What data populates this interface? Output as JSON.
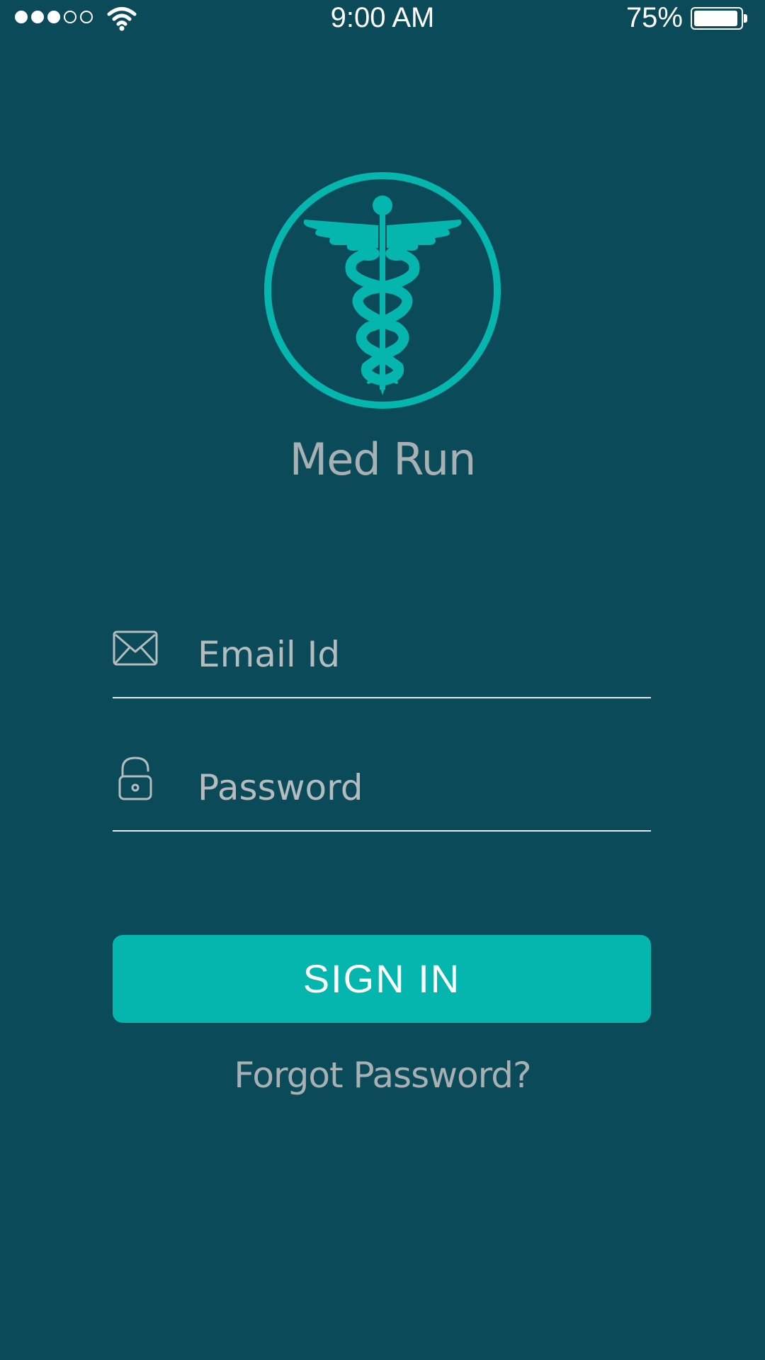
{
  "status_bar": {
    "signal_total": 5,
    "signal_filled": 3,
    "time": "9:00 AM",
    "battery_percent": "75%",
    "battery_level": 0.95,
    "wifi_icon": "wifi-icon"
  },
  "logo": {
    "icon": "caduceus-icon",
    "color": "#04b6ad"
  },
  "app_name": "Med Run",
  "form": {
    "email": {
      "icon": "mail-icon",
      "placeholder": "Email Id",
      "value": ""
    },
    "password": {
      "icon": "lock-icon",
      "placeholder": "Password",
      "value": ""
    }
  },
  "sign_in_label": "SIGN IN",
  "forgot_password_label": "Forgot Password?",
  "colors": {
    "background": "#0b4a58",
    "accent": "#04b6ad",
    "muted_text": "#a7b1b3",
    "divider": "#e4eaeb"
  }
}
